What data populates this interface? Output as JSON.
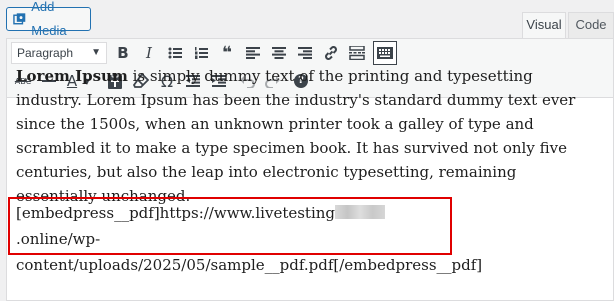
{
  "header": {
    "add_media_label": "Add Media",
    "tabs": [
      {
        "label": "Visual",
        "active": true
      },
      {
        "label": "Code",
        "active": false
      }
    ]
  },
  "toolbar": {
    "format_select_value": "Paragraph",
    "row1_icons": [
      "bold-icon",
      "italic-icon",
      "bulleted-list-icon",
      "numbered-list-icon",
      "blockquote-icon",
      "align-left-icon",
      "align-center-icon",
      "align-right-icon",
      "link-icon",
      "read-more-icon",
      "toolbar-toggle-icon"
    ],
    "row2_icons": [
      "strikethrough-icon",
      "horizontal-line-icon",
      "text-color-icon",
      "paste-as-text-icon",
      "clear-formatting-icon",
      "special-character-icon",
      "outdent-icon",
      "indent-icon",
      "undo-icon",
      "redo-icon",
      "help-icon"
    ],
    "bold_glyph": "B",
    "italic_glyph": "I",
    "strike_glyph": "ABC",
    "text_color_glyph": "A",
    "special_char_glyph": "Ω",
    "quote_glyph": "❝",
    "help_glyph": "?"
  },
  "content": {
    "lead_bold": "Lorem Ipsum",
    "lead_rest": " is simply dummy text of the printing and typesetting industry. Lorem Ipsum has been the industry's standard dummy text ever since the 1500s, when an unknown printer took a galley of type and scrambled it to make a type specimen book. It has survived not only five centuries, but also the leap into electronic typesetting, remaining essentially unchanged.",
    "embed_prefix": "[embedpress__pdf]https://www.livetesting",
    "embed_suffix": ".online/wp-content/uploads/2025/05/sample__pdf.pdf[/embedpress__pdf]"
  },
  "colors": {
    "accent": "#2271b1",
    "highlight_border": "#e00000"
  }
}
